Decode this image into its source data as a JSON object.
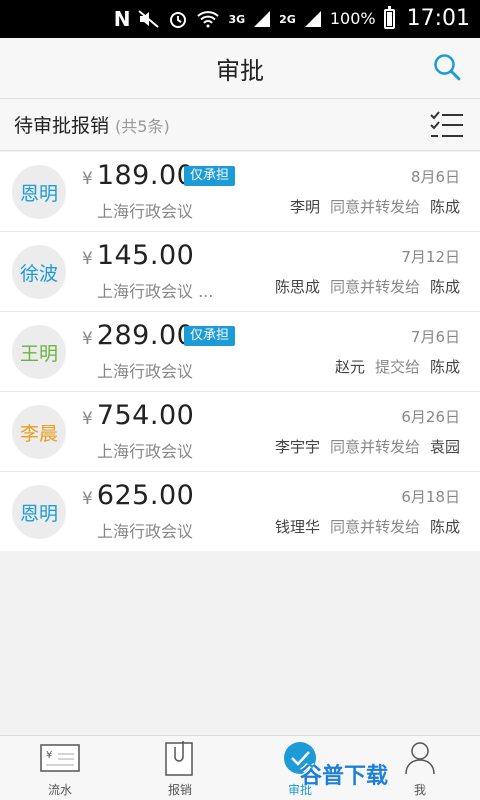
{
  "status_bar": {
    "network_3g": "3G",
    "network_2g": "2G",
    "battery": "100%",
    "time": "17:01"
  },
  "header": {
    "title": "审批"
  },
  "section": {
    "title": "待审批报销",
    "count": "(共5条)"
  },
  "currency": "¥",
  "items": [
    {
      "avatar": "恩明",
      "avatar_color": "#1d9bd7",
      "amount": "189.00",
      "badge": "仅承担",
      "date": "8月6日",
      "desc": "上海行政会议",
      "from": "李明",
      "action": "同意并转发给",
      "to": "陈成"
    },
    {
      "avatar": "徐波",
      "avatar_color": "#1d9bd7",
      "amount": "145.00",
      "badge": "",
      "date": "7月12日",
      "desc": "上海行政会议 ...",
      "from": "陈思成",
      "action": "同意并转发给",
      "to": "陈成"
    },
    {
      "avatar": "王明",
      "avatar_color": "#6cb33e",
      "amount": "289.00",
      "badge": "仅承担",
      "date": "7月6日",
      "desc": "上海行政会议",
      "from": "赵元",
      "action": "提交给",
      "to": "陈成"
    },
    {
      "avatar": "李晨",
      "avatar_color": "#e8a020",
      "amount": "754.00",
      "badge": "",
      "date": "6月26日",
      "desc": "上海行政会议",
      "from": "李宇宇",
      "action": "同意并转发给",
      "to": "袁园"
    },
    {
      "avatar": "恩明",
      "avatar_color": "#1d9bd7",
      "amount": "625.00",
      "badge": "",
      "date": "6月18日",
      "desc": "上海行政会议",
      "from": "钱理华",
      "action": "同意并转发给",
      "to": "陈成"
    }
  ],
  "nav": {
    "flow": "流水",
    "expense": "报销",
    "approval": "审批",
    "me": "我"
  },
  "watermark": "谷普下载",
  "accent_color": "#1d9bd7"
}
